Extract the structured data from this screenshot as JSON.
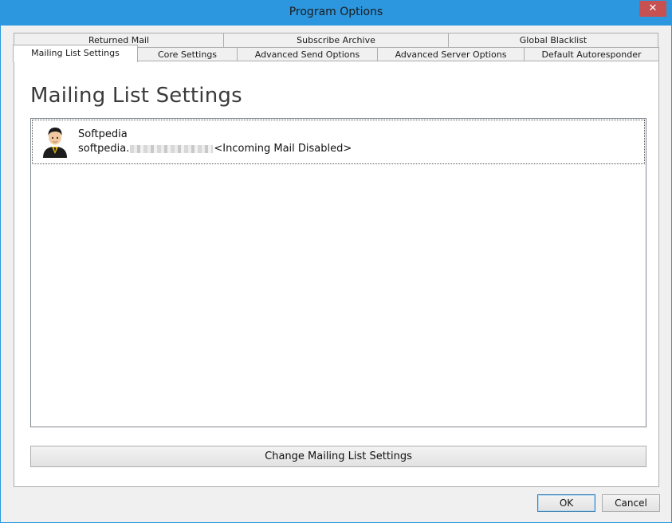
{
  "window": {
    "title": "Program Options",
    "close_glyph": "✕"
  },
  "tabs_back": [
    {
      "label": "Returned Mail"
    },
    {
      "label": "Subscribe Archive"
    },
    {
      "label": "Global Blacklist"
    }
  ],
  "tabs_front": [
    {
      "label": "Mailing List Settings",
      "active": true
    },
    {
      "label": "Core Settings"
    },
    {
      "label": "Advanced Send Options"
    },
    {
      "label": "Advanced Server Options"
    },
    {
      "label": "Default Autoresponder"
    }
  ],
  "page": {
    "title": "Mailing List Settings"
  },
  "list": {
    "items": [
      {
        "name": "Softpedia",
        "email_prefix": "softpedia.",
        "status": "<Incoming Mail Disabled>",
        "icon": "user-avatar-icon"
      }
    ]
  },
  "actions": {
    "change_label": "Change Mailing List Settings"
  },
  "footer": {
    "ok_label": "OK",
    "cancel_label": "Cancel"
  },
  "colors": {
    "titlebar": "#2c97de",
    "close": "#c75050",
    "panel_bg": "#ffffff",
    "dialog_bg": "#f0f0f0"
  }
}
